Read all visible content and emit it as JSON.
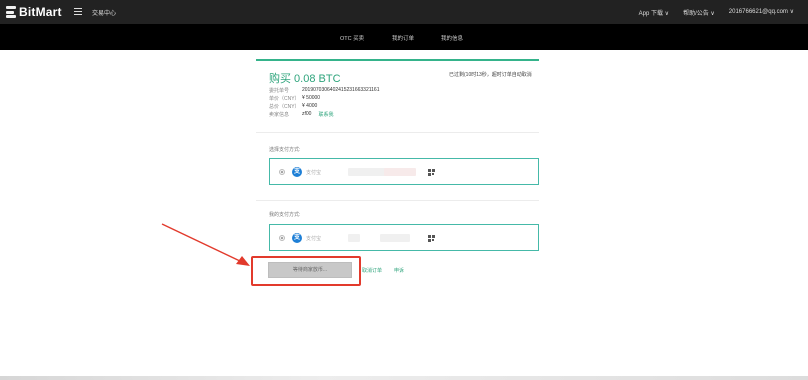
{
  "header": {
    "brand": "BitMart",
    "exchange_center": "交易中心",
    "app_download": "App 下载 ∨",
    "help": "帮助/公告 ∨",
    "account": "2016766621@qq.com ∨"
  },
  "subnav": {
    "tabs": [
      {
        "label": "OTC 买卖"
      },
      {
        "label": "我的订单"
      },
      {
        "label": "我的信息"
      }
    ]
  },
  "order": {
    "title": "购买 0.08 BTC",
    "countdown": "已过剩(10时13秒，超时订单自动取消",
    "rows": [
      {
        "key": "委托单号",
        "value": "2019070306402415231663321161"
      },
      {
        "key": "单价（CNY）",
        "value": "¥ 50000"
      },
      {
        "key": "总价（CNY）",
        "value": "¥ 4000"
      },
      {
        "key": "卖家信息",
        "value": "zf00"
      }
    ],
    "contact_label": "联系我"
  },
  "payment": {
    "select_label": "选择支付方式:",
    "my_label": "我的支付方式:",
    "selected": {
      "method": "支付宝",
      "qr_icon": "qr-code-icon"
    },
    "mine": {
      "method": "支付宝",
      "qr_icon": "qr-code-icon"
    }
  },
  "actions": {
    "wait_button": "等待商家放币...",
    "cancel": "取消订单",
    "appeal": "申诉"
  },
  "colors": {
    "accent": "#2ea47c",
    "box_border": "#45b9a8",
    "annotation": "#e23a2c"
  }
}
